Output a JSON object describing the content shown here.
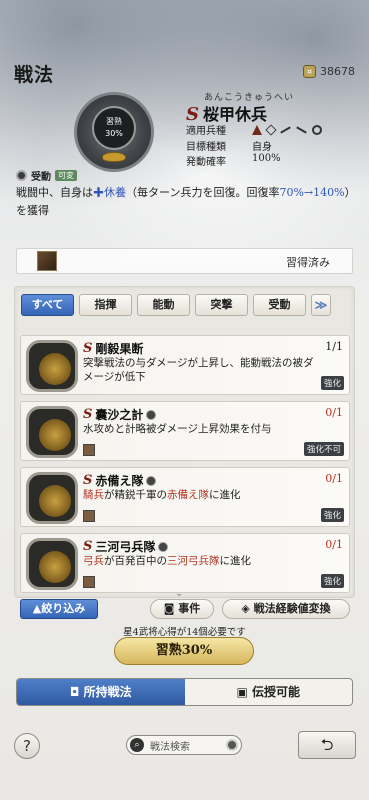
{
  "header": {
    "title": "戦法",
    "currency_value": "38678",
    "currency_icon": "coin-icon"
  },
  "skill": {
    "emblem_text_line1": "習熟",
    "emblem_text_line2": "30%",
    "ruby": "あんこうきゅうへい",
    "rank": "S",
    "name": "桜甲休兵",
    "rows": [
      {
        "key": "適用兵種",
        "value": ""
      },
      {
        "key": "目標種類",
        "value": "自身"
      },
      {
        "key": "発動確率",
        "value": "100%"
      }
    ],
    "unit_icons": [
      "spear-icon",
      "cavalry-icon",
      "bow-icon",
      "gun-icon",
      "ship-icon"
    ],
    "type_label": "受動",
    "grow_badge": "可変",
    "desc_before": "戦闘中、自身は",
    "desc_effect": "休養",
    "desc_mid": "（毎ターン兵力を回復。回復率",
    "desc_rate": "70%→140%",
    "desc_after": "）を獲得"
  },
  "learned": {
    "label": "習得済み"
  },
  "tabs": [
    {
      "label": "すべて",
      "active": true
    },
    {
      "label": "指揮",
      "active": false
    },
    {
      "label": "能動",
      "active": false
    },
    {
      "label": "突撃",
      "active": false
    },
    {
      "label": "受動",
      "active": false
    },
    {
      "label": "≫",
      "active": false
    }
  ],
  "cards": [
    {
      "rank": "S",
      "name": "剛毅果断",
      "count": "1/1",
      "desc_parts": [
        {
          "text": "突撃戦法の与ダメージが上昇し、能動戦法の被ダメージが低下",
          "red": false
        }
      ],
      "status": "強化"
    },
    {
      "rank": "S",
      "name": "囊沙之計",
      "count": "0/1",
      "desc_parts": [
        {
          "text": "水攻めと計略被ダメージ上昇効果を付与",
          "red": false
        }
      ],
      "status": "強化不可"
    },
    {
      "rank": "S",
      "name": "赤備え隊",
      "count": "0/1",
      "desc_parts": [
        {
          "text": "騎兵",
          "red": true
        },
        {
          "text": "が精鋭千軍の",
          "red": false
        },
        {
          "text": "赤備え隊",
          "red": true
        },
        {
          "text": "に進化",
          "red": false
        }
      ],
      "status": "強化"
    },
    {
      "rank": "S",
      "name": "三河弓兵隊",
      "count": "0/1",
      "desc_parts": [
        {
          "text": "弓兵",
          "red": true
        },
        {
          "text": "が百発百中の",
          "red": false
        },
        {
          "text": "三河弓兵隊",
          "red": true
        },
        {
          "text": "に進化",
          "red": false
        }
      ],
      "status": "強化"
    }
  ],
  "buttons": {
    "filter": "絞り込み",
    "event": "事件",
    "convert": "戦法経験値変換",
    "note": "星4武将心得が14個必要です",
    "master": "習熟30%"
  },
  "toggle": {
    "owned": "所持戦法",
    "teachable": "伝授可能"
  },
  "footer": {
    "help": "?",
    "search_placeholder": "戦法検索",
    "back": "⮌"
  }
}
